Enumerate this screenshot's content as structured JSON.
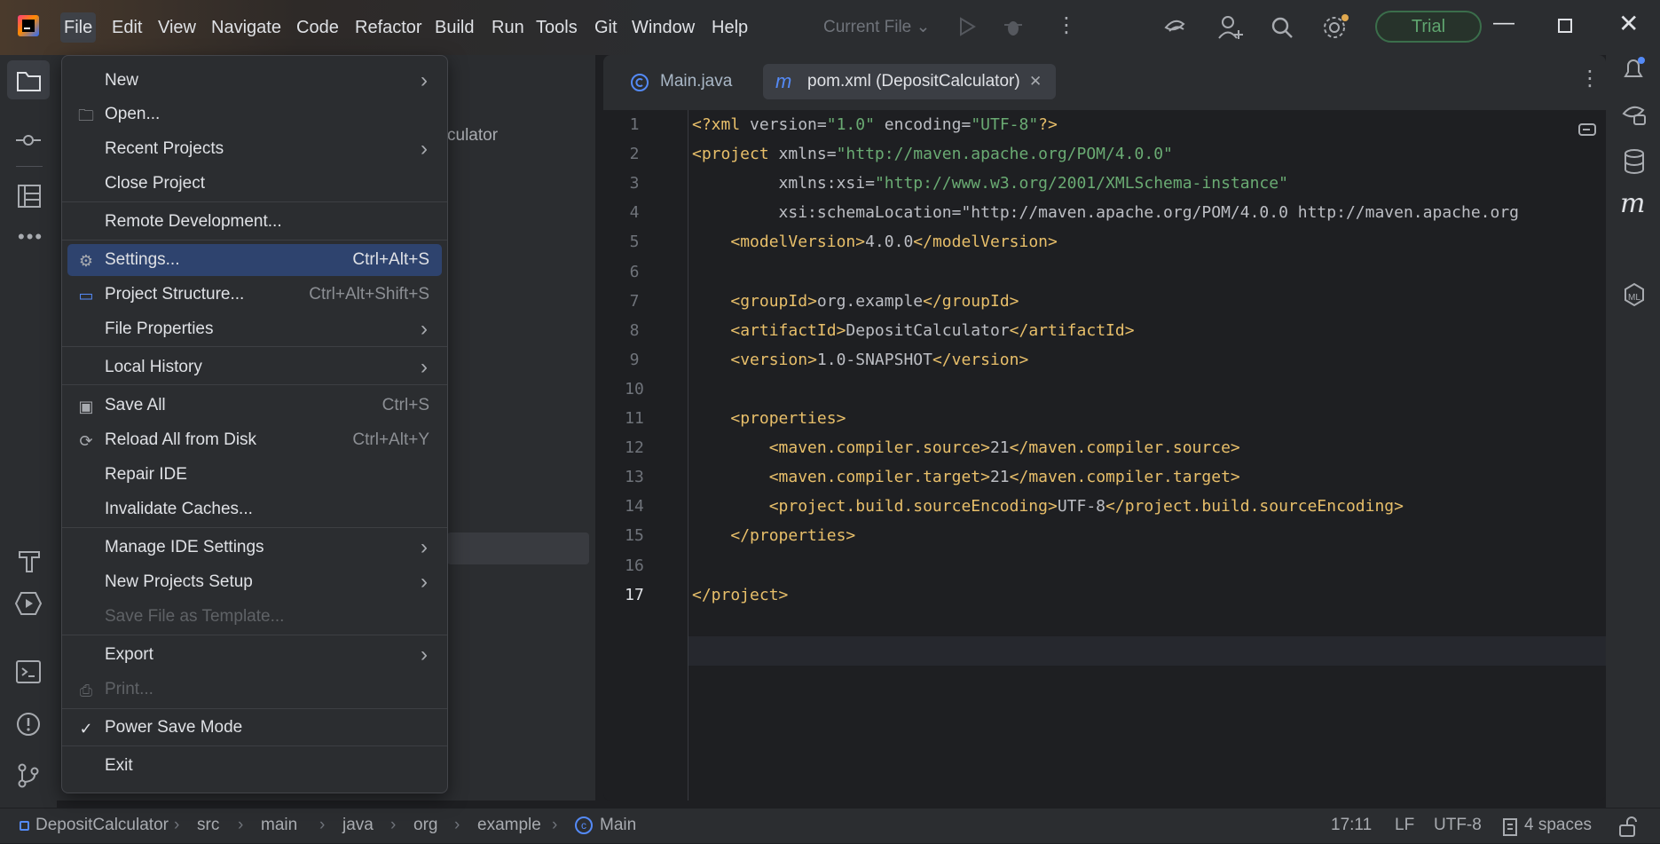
{
  "menubar": {
    "items": [
      "File",
      "Edit",
      "View",
      "Navigate",
      "Code",
      "Refactor",
      "Build",
      "Run",
      "Tools",
      "Git",
      "Window",
      "Help"
    ],
    "run_config": "Current File",
    "trial": "Trial"
  },
  "project_panel": {
    "partial_text": "culator"
  },
  "file_menu": {
    "items": [
      {
        "label": "New",
        "arrow": true
      },
      {
        "label": "Open...",
        "icon": "folder-icon"
      },
      {
        "label": "Recent Projects",
        "arrow": true
      },
      {
        "label": "Close Project"
      },
      {
        "label": "Remote Development..."
      },
      {
        "label": "Settings...",
        "shortcut": "Ctrl+Alt+S",
        "icon": "gear-icon",
        "highlighted": true
      },
      {
        "label": "Project Structure...",
        "shortcut": "Ctrl+Alt+Shift+S",
        "icon": "project-structure-icon"
      },
      {
        "label": "File Properties",
        "arrow": true
      },
      {
        "label": "Local History",
        "arrow": true
      },
      {
        "label": "Save All",
        "shortcut": "Ctrl+S",
        "icon": "save-icon"
      },
      {
        "label": "Reload All from Disk",
        "shortcut": "Ctrl+Alt+Y",
        "icon": "reload-icon"
      },
      {
        "label": "Repair IDE"
      },
      {
        "label": "Invalidate Caches..."
      },
      {
        "label": "Manage IDE Settings",
        "arrow": true
      },
      {
        "label": "New Projects Setup",
        "arrow": true
      },
      {
        "label": "Save File as Template...",
        "disabled": true
      },
      {
        "label": "Export",
        "arrow": true
      },
      {
        "label": "Print...",
        "disabled": true,
        "icon": "print-icon"
      },
      {
        "label": "Power Save Mode",
        "icon": "check-icon"
      },
      {
        "label": "Exit"
      }
    ]
  },
  "tabs": [
    {
      "label": "Main.java",
      "icon": "java-class-icon"
    },
    {
      "label": "pom.xml (DepositCalculator)",
      "icon": "maven-icon",
      "selected": true
    }
  ],
  "editor": {
    "line_numbers": [
      "1",
      "2",
      "3",
      "4",
      "5",
      "6",
      "7",
      "8",
      "9",
      "10",
      "11",
      "12",
      "13",
      "14",
      "15",
      "16",
      "17"
    ],
    "lines": [
      "<?xml version=\"1.0\" encoding=\"UTF-8\"?>",
      "<project xmlns=\"http://maven.apache.org/POM/4.0.0\"",
      "         xmlns:xsi=\"http://www.w3.org/2001/XMLSchema-instance\"",
      "         xsi:schemaLocation=\"http://maven.apache.org/POM/4.0.0 http://maven.apache.org",
      "    <modelVersion>4.0.0</modelVersion>",
      "",
      "    <groupId>org.example</groupId>",
      "    <artifactId>DepositCalculator</artifactId>",
      "    <version>1.0-SNAPSHOT</version>",
      "",
      "    <properties>",
      "        <maven.compiler.source>21</maven.compiler.source>",
      "        <maven.compiler.target>21</maven.compiler.target>",
      "        <project.build.sourceEncoding>UTF-8</project.build.sourceEncoding>",
      "    </properties>",
      "",
      "</project>"
    ]
  },
  "statusbar": {
    "breadcrumb": [
      "DepositCalculator",
      "src",
      "main",
      "java",
      "org",
      "example",
      "Main"
    ],
    "position": "17:11",
    "line_ending": "LF",
    "encoding": "UTF-8",
    "indent": "4 spaces"
  },
  "colors": {
    "accent": "#2e436e",
    "tag": "#e8bf6a",
    "string": "#6aab73",
    "trial": "#5fa56f"
  }
}
